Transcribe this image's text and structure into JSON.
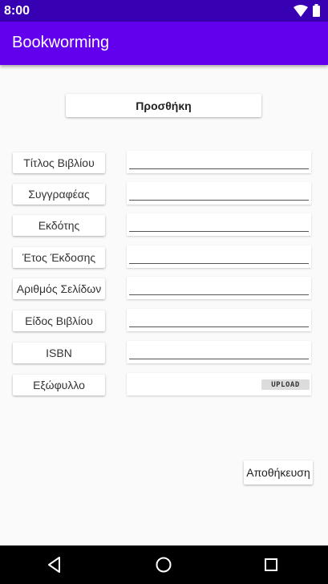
{
  "status": {
    "time": "8:00",
    "icons": [
      "wifi-icon",
      "battery-icon"
    ]
  },
  "app": {
    "title": "Bookworming"
  },
  "add_button": {
    "label": "Προσθήκη"
  },
  "fields": [
    {
      "label": "Τίτλος Βιβλίου",
      "value": ""
    },
    {
      "label": "Συγγραφέας",
      "value": ""
    },
    {
      "label": "Εκδότης",
      "value": ""
    },
    {
      "label": "Έτος Έκδοσης",
      "value": ""
    },
    {
      "label": "Αριθμός Σελίδων",
      "value": ""
    },
    {
      "label": "Είδος Βιβλίου",
      "value": ""
    },
    {
      "label": "ISBN",
      "value": ""
    }
  ],
  "cover": {
    "label": "Εξώφυλλο",
    "upload_label": "UPLOAD"
  },
  "save_button": {
    "label": "Αποθήκευση"
  },
  "nav": {
    "icons": [
      "back-icon",
      "home-icon",
      "recents-icon"
    ]
  },
  "colors": {
    "status_bar": "#3700b3",
    "app_bar": "#6200ee",
    "background": "#fafafa"
  }
}
